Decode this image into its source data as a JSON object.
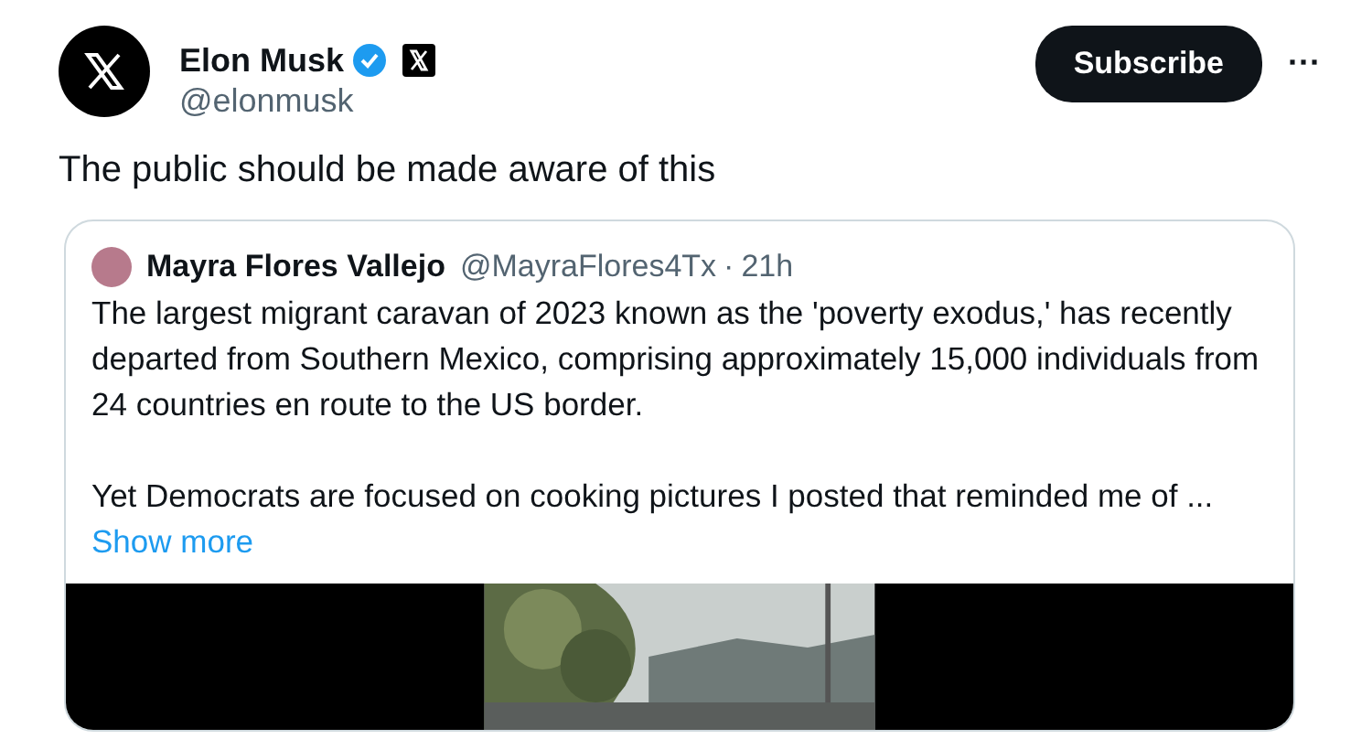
{
  "author": {
    "name": "Elon Musk",
    "verified": true,
    "handle": "@elonmusk"
  },
  "subscribe_button": "Subscribe",
  "more_button": "···",
  "tweet_text": "The public should be made aware of this",
  "quoted_tweet": {
    "name": "Mayra Flores Vallejo",
    "handle": "@MayraFlores4Tx",
    "separator": "·",
    "time": "21h",
    "paragraphs": [
      "The largest migrant caravan of 2023 known as the 'poverty exodus,' has recently departed from Southern Mexico, comprising approximately 15,000 individuals from 24 countries en route to the US border.",
      "Yet Democrats are focused on cooking pictures I posted that reminded me of ..."
    ],
    "show_more": "Show more"
  }
}
